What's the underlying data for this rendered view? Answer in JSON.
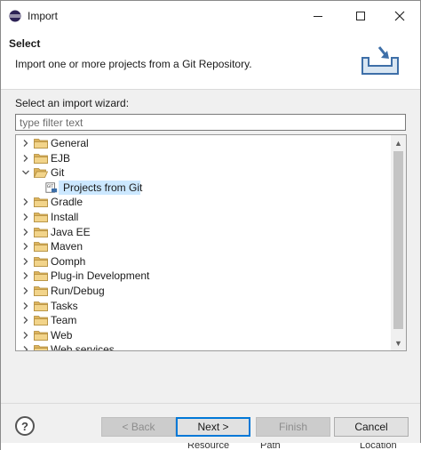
{
  "window": {
    "title": "Import",
    "controls": {
      "minimize": "—",
      "maximize": "☐",
      "close": "✕"
    }
  },
  "banner": {
    "title": "Select",
    "description": "Import one or more projects from a Git Repository.",
    "icon": "import-wizard-icon"
  },
  "wizard": {
    "label": "Select an import wizard:",
    "filter_placeholder": "type filter text",
    "tree": [
      {
        "label": "General",
        "expanded": false
      },
      {
        "label": "EJB",
        "expanded": false
      },
      {
        "label": "Git",
        "expanded": true
      },
      {
        "label": "Projects from Git",
        "child": true,
        "selected": true
      },
      {
        "label": "Gradle",
        "expanded": false
      },
      {
        "label": "Install",
        "expanded": false
      },
      {
        "label": "Java EE",
        "expanded": false
      },
      {
        "label": "Maven",
        "expanded": false
      },
      {
        "label": "Oomph",
        "expanded": false
      },
      {
        "label": "Plug-in Development",
        "expanded": false
      },
      {
        "label": "Run/Debug",
        "expanded": false
      },
      {
        "label": "Tasks",
        "expanded": false
      },
      {
        "label": "Team",
        "expanded": false
      },
      {
        "label": "Web",
        "expanded": false
      },
      {
        "label": "Web services",
        "expanded": false
      }
    ]
  },
  "footer": {
    "help": "?",
    "back": "< Back",
    "next": "Next >",
    "finish": "Finish",
    "cancel": "Cancel"
  },
  "background": {
    "col1": "Resource",
    "col2": "Path",
    "col3": "Location"
  },
  "colors": {
    "selection": "#cce8ff",
    "default_button_border": "#0078d7",
    "folder": "#dcb35c"
  }
}
